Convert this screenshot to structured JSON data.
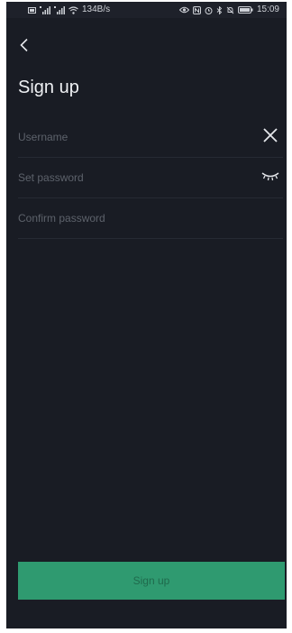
{
  "status_bar": {
    "net_speed": "134B/s",
    "time": "15:09",
    "left_icons": [
      "sim-icon",
      "signal-4g-icon",
      "signal-4g-icon",
      "wifi-icon"
    ],
    "right_icons": [
      "eye-icon",
      "nfc-icon",
      "alarm-icon",
      "bluetooth-icon",
      "mute-icon",
      "battery-icon"
    ]
  },
  "header": {
    "back_icon": "chevron-left-icon",
    "title": "Sign up"
  },
  "form": {
    "username": {
      "placeholder": "Username",
      "value": "",
      "action_icon": "close-icon"
    },
    "password": {
      "placeholder": "Set password",
      "value": "",
      "action_icon": "eye-closed-icon"
    },
    "confirm_password": {
      "placeholder": "Confirm password",
      "value": ""
    }
  },
  "submit": {
    "label": "Sign up"
  },
  "colors": {
    "background": "#191c24",
    "accent": "#2f9a70",
    "divider": "#262a33",
    "placeholder": "#5d626b"
  }
}
